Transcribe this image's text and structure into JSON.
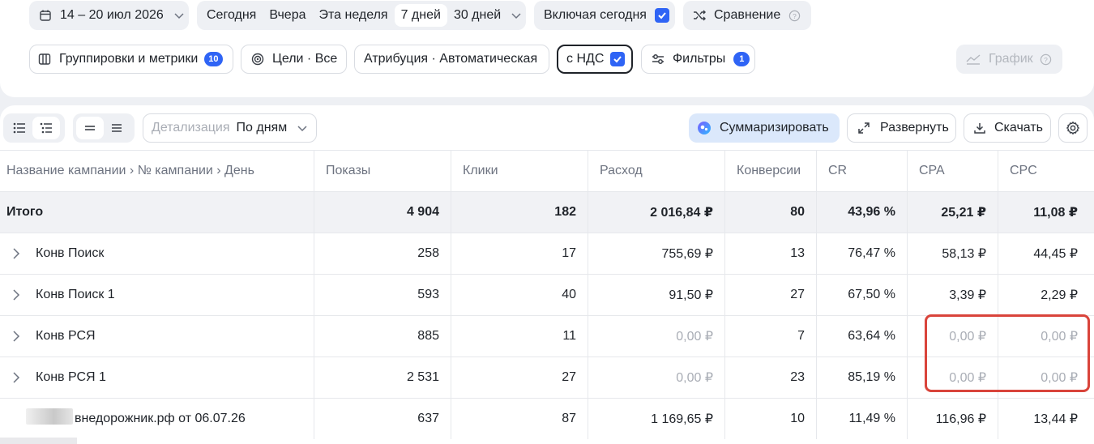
{
  "toolbar": {
    "date_range": "14 – 20 июл 2026",
    "period_options": [
      "Сегодня",
      "Вчера",
      "Эта неделя",
      "7 дней",
      "30 дней"
    ],
    "period_active": "7 дней",
    "include_today_label": "Включая сегодня",
    "compare_label": "Сравнение",
    "groupings_label": "Группировки и метрики",
    "groupings_count": "10",
    "goals_label": "Цели · Все",
    "attribution_label": "Атрибуция · Автоматическая",
    "vat_label": "с НДС",
    "filters_label": "Фильтры",
    "filters_count": "1",
    "chart_label": "График"
  },
  "table_toolbar": {
    "detail_label": "Детализация",
    "detail_value": "По дням",
    "summarize_label": "Суммаризировать",
    "expand_label": "Развернуть",
    "download_label": "Скачать"
  },
  "table": {
    "headers": [
      "Название кампании › № кампании › День",
      "Показы",
      "Клики",
      "Расход",
      "Конверсии",
      "CR",
      "CPA",
      "CPC"
    ],
    "total": [
      "Итого",
      "4 904",
      "182",
      "2 016,84 ₽",
      "80",
      "43,96 %",
      "25,21 ₽",
      "11,08 ₽"
    ],
    "rows": [
      [
        "Конв Поиск",
        "258",
        "17",
        "755,69 ₽",
        "13",
        "76,47 %",
        "58,13 ₽",
        "44,45 ₽"
      ],
      [
        "Конв Поиск 1",
        "593",
        "40",
        "91,50 ₽",
        "27",
        "67,50 %",
        "3,39 ₽",
        "2,29 ₽"
      ],
      [
        "Конв РСЯ",
        "885",
        "11",
        "0,00 ₽",
        "7",
        "63,64 %",
        "0,00 ₽",
        "0,00 ₽"
      ],
      [
        "Конв РСЯ 1",
        "2 531",
        "27",
        "0,00 ₽",
        "23",
        "85,19 %",
        "0,00 ₽",
        "0,00 ₽"
      ],
      [
        "внедорожник.рф от 06.07.26",
        "637",
        "87",
        "1 169,65 ₽",
        "10",
        "11,49 %",
        "116,96 ₽",
        "13,44 ₽"
      ]
    ]
  },
  "colors": {
    "accent": "#2f64f5",
    "highlight": "#d9443b",
    "muted": "#a9adb5"
  }
}
